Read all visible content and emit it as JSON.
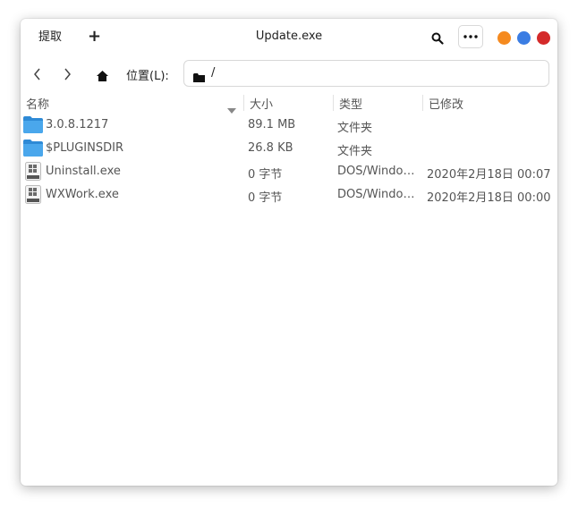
{
  "titlebar": {
    "extract_label": "提取",
    "add_label": "+",
    "title": "Update.exe",
    "window_controls": {
      "minimize_color": "#f58a1f",
      "maximize_color": "#3b7de3",
      "close_color": "#d42a2a"
    }
  },
  "navbar": {
    "location_label": "位置(L):",
    "path": "/"
  },
  "columns": {
    "name": "名称",
    "size": "大小",
    "type": "类型",
    "modified": "已修改"
  },
  "files": [
    {
      "name": "3.0.8.1217",
      "size": "89.1 MB",
      "type": "文件夹",
      "modified": "",
      "icon": "folder-icon"
    },
    {
      "name": "$PLUGINSDIR",
      "size": "26.8 KB",
      "type": "文件夹",
      "modified": "",
      "icon": "folder-icon"
    },
    {
      "name": "Uninstall.exe",
      "size": "0 字节",
      "type": "DOS/Windo…",
      "modified": "2020年2月18日 00:07",
      "icon": "executable-icon"
    },
    {
      "name": "WXWork.exe",
      "size": "0 字节",
      "type": "DOS/Windo…",
      "modified": "2020年2月18日 00:00",
      "icon": "executable-icon"
    }
  ]
}
